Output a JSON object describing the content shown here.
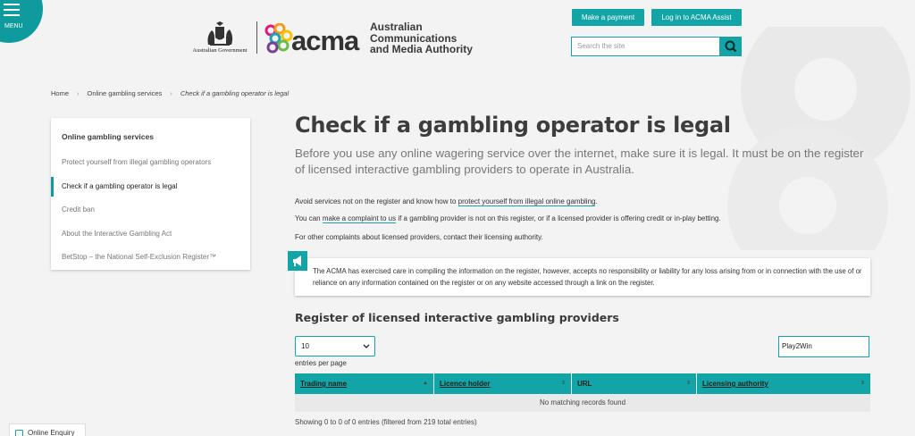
{
  "header": {
    "menu_label": "MENU",
    "gov_label": "Australian Government",
    "acma_short": "acma",
    "acma_full": [
      "Australian",
      "Communications",
      "and Media Authority"
    ],
    "make_payment": "Make a payment",
    "login": "Log in to ACMA Assist",
    "search_placeholder": "Search the site"
  },
  "breadcrumb": {
    "home": "Home",
    "section": "Online gambling services",
    "current": "Check if a gambling operator is legal"
  },
  "side_nav": {
    "heading": "Online gambling services",
    "items": [
      {
        "label": "Protect yourself from illegal gambling operators",
        "active": false
      },
      {
        "label": "Check if a gambling operator is legal",
        "active": true
      },
      {
        "label": "Credit ban",
        "active": false
      },
      {
        "label": "About the Interactive Gambling Act",
        "active": false
      },
      {
        "label": "BetStop – the National Self-Exclusion Register™",
        "active": false
      }
    ]
  },
  "main": {
    "title": "Check if a gambling operator is legal",
    "intro": "Before you use any online wagering service over the internet, make sure it is legal. It must be on the register of licensed interactive gambling providers to operate in Australia.",
    "p1_pre": "Avoid services not on the register and know how to ",
    "p1_link": "protect yourself from illegal online gambling",
    "p1_post": ".",
    "p2_pre": "You can ",
    "p2_link": "make a complaint to us",
    "p2_post": " if a gambling provider is not on this register, or if a licensed provider is offering credit or in-play betting.",
    "p3": "For other complaints about licensed providers, contact their licensing authority.",
    "notice": "The ACMA has exercised care in compiling the information on the register, however, accepts no responsibility or liability for any loss arising from or in connection with the use of or reliance on any information contained on the register or on any website accessed through a link on the register."
  },
  "register": {
    "title": "Register of licensed interactive gambling providers",
    "entries_value": "10",
    "entries_label": "entries per page",
    "search_value": "Play2Win",
    "columns": [
      "Trading name",
      "Licence holder",
      "URL",
      "Licensing authority"
    ],
    "empty_message": "No matching records found",
    "info": "Showing 0 to 0 of 0 entries (filtered from 219 total entries)"
  },
  "online_enquiry": "Online Enquiry",
  "colors": {
    "accent": "#12a4a6",
    "background": "#f3f3f3"
  }
}
